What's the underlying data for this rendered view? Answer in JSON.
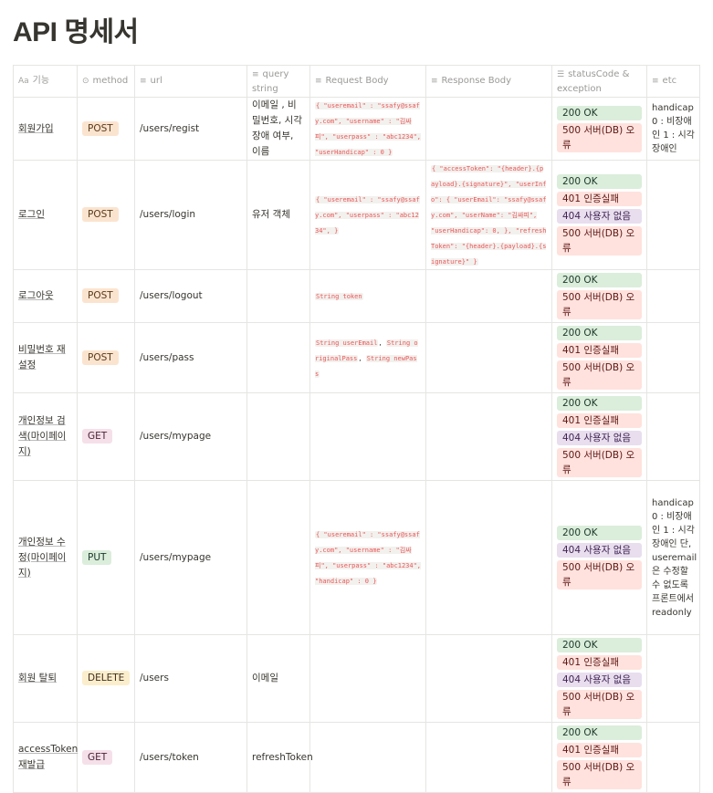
{
  "page_title": "API 명세서",
  "columns": {
    "name": "기능",
    "method": "method",
    "url": "url",
    "query": "query string",
    "request": "Request Body",
    "response": "Response Body",
    "status": "statusCode & exception",
    "etc": "etc"
  },
  "rows": [
    {
      "name": "회원가입",
      "method": "POST",
      "url": "/users/regist",
      "query": "이메일 , 비밀번호, 시각장애 여부, 이름",
      "request": "{ \"useremail\" : \"ssafy@ssafy.com\", \"username\" : \"김싸피\", \"userpass\" : \"abc1234\", \"userHandicap\" : 0 }",
      "response": "",
      "status": [
        "200 OK",
        "500 서버(DB) 오류"
      ],
      "etc": "handicap 0 : 비장애인 1 : 시각장애인"
    },
    {
      "name": "로그인",
      "method": "POST",
      "url": "/users/login",
      "query": "유저 객체",
      "request": "{ \"useremail\" : \"ssafy@ssafy.com\", \"userpass\" : \"abc1234\", }",
      "response": "{ \"accessToken\": \"{header}.{payload}.{signature}\", \"userInfo\": { \"userEmail\": \"ssafy@ssafy.com\", \"userName\": \"김싸피\", \"userHandicap\": 0, }, \"refreshToken\": \"{header}.{payload}.{signature}\" }",
      "status": [
        "200 OK",
        "401 인증실패",
        "404 사용자 없음",
        "500 서버(DB) 오류"
      ],
      "etc": ""
    },
    {
      "name": "로그아웃",
      "method": "POST",
      "url": "/users/logout",
      "query": "",
      "request": "String token",
      "response": "",
      "status": [
        "200 OK",
        "500 서버(DB) 오류"
      ],
      "etc": ""
    },
    {
      "name": "비밀번호 재설정",
      "method": "POST",
      "url": "/users/pass",
      "query": "",
      "request_parts": [
        "String userEmail",
        ", ",
        "String originalPass",
        ", ",
        "String newPass"
      ],
      "response": "",
      "status": [
        "200 OK",
        "401 인증실패",
        "500 서버(DB) 오류"
      ],
      "etc": ""
    },
    {
      "name": "개인정보 검색(마이페이지)",
      "method": "GET",
      "url": "/users/mypage",
      "query": "",
      "request": "",
      "response": "",
      "status": [
        "200 OK",
        "401 인증실패",
        "404 사용자 없음",
        "500 서버(DB) 오류"
      ],
      "etc": ""
    },
    {
      "name": "개인정보 수정(마이페이지)",
      "method": "PUT",
      "url": "/users/mypage",
      "query": "",
      "request": "{ \"useremail\" : \"ssafy@ssafy.com\", \"username\" : \"김싸피\", \"userpass\" : \"abc1234\", \"handicap\" : 0 }",
      "response": "",
      "status": [
        "200 OK",
        "404 사용자 없음",
        "500 서버(DB) 오류"
      ],
      "etc": "handicap 0 : 비장애인 1 : 시각장애인 단, useremail은 수정할 수 없도록 프론트에서 readonly"
    },
    {
      "name": "회원 탈퇴",
      "method": "DELETE",
      "url": "/users",
      "query": "이메일",
      "request": "",
      "response": "",
      "status": [
        "200 OK",
        "401 인증실패",
        "404 사용자 없음",
        "500 서버(DB) 오류"
      ],
      "etc": ""
    },
    {
      "name": "accessToken 재발급",
      "method": "GET",
      "url": "/users/token",
      "query": "refreshToken",
      "request": "",
      "response": "",
      "status": [
        "200 OK",
        "401 인증실패",
        "500 서버(DB) 오류"
      ],
      "etc": ""
    }
  ]
}
